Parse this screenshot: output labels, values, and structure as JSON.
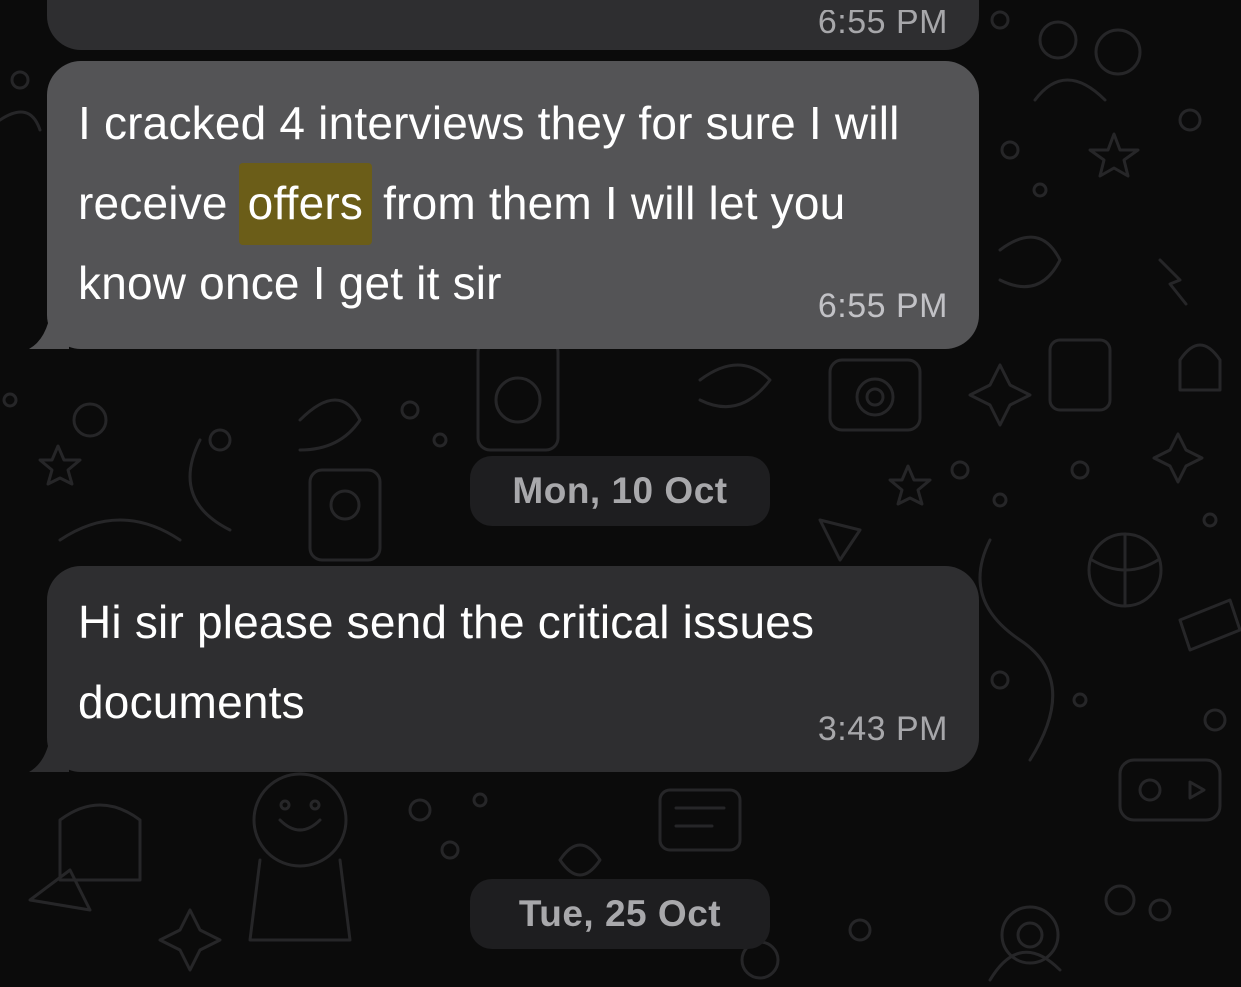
{
  "messages": [
    {
      "time": "6:55 PM"
    },
    {
      "text_before": "I cracked 4 interviews they for sure I will receive ",
      "text_highlight": "offers",
      "text_after": " from them I will let you know once I get it sir",
      "time": "6:55 PM"
    },
    {
      "text": "Hi sir please send the critical issues documents",
      "time": "3:43 PM"
    }
  ],
  "date_separators": [
    {
      "label": "Mon, 10 Oct"
    },
    {
      "label": "Tue, 25 Oct"
    }
  ],
  "colors": {
    "background": "#0b0b0b",
    "bubble": "#2e2e30",
    "bubble_highlighted": "#545456",
    "search_highlight": "#6b5d18",
    "date_chip": "#1e1e20",
    "timestamp": "#a7a7aa"
  }
}
